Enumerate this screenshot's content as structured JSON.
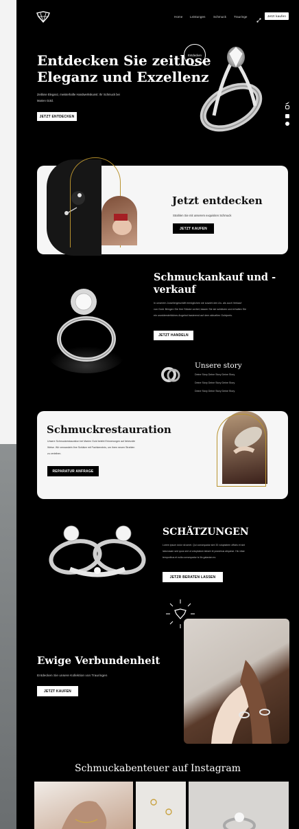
{
  "nav": {
    "items": [
      "Home",
      "Leistungen",
      "Schmuck",
      "Trauringe"
    ],
    "cta": "Jetzt kaufen"
  },
  "hero": {
    "title_line1": "Entdecken Sie zeitlose",
    "title_line2": "Eleganz und Exzellenz",
    "badge": "Entdecken",
    "subtitle_line1": "Zeitlose Eleganz, meisterhafte Handwerkskunst: Ihr Schmuck bei",
    "subtitle_line2": "Marien Gold.",
    "button": "JETZT ENTDECKEN"
  },
  "discover": {
    "title": "Jetzt entdecken",
    "text": "Strahlen Sie mit unserem exquisiten Schmuck",
    "button": "JETZT KAUFEN"
  },
  "trade": {
    "title_line1": "Schmuckankauf und -",
    "title_line2": "verkauf",
    "text_line1": "In unserem Juweliergeschäft ermöglichen wir sowohl den An- als auch Verkauf",
    "text_line2": "von Gold. Bringen Sie Ihre Stücke vorbei; lassen Sie sie schätzen und erhalten Sie",
    "text_line3": "ein unwiderstehliches Angebot basierend auf dem aktuellen Goldpreis.",
    "button": "JETZT HANDELN"
  },
  "story": {
    "title": "Unsere story",
    "lines": [
      "Deine Story Deine Story Deine Story",
      "Deine Story Deine Story Deine Story",
      "Deine Story Deine Story Deine Story"
    ]
  },
  "restoration": {
    "title": "Schmuckrestauration",
    "text_line1": "Unsere Schmuckrestauration bei Marien Gold belebt Erinnerungen auf liebevolle",
    "text_line2": "Weise. Wir verwandeln Ihre Schätze mit Fachkenntnis, um ihren neuen Strahlen",
    "text_line3": "zu verleihen.",
    "button": "REPARATUR ANFRAGE"
  },
  "appraisal": {
    "title": "SCHÄTZUNGEN",
    "text_line1": "Lorem ipsum dolor sit amet. Qui consequatur sint 33 voluptatem officiis et sint",
    "text_line2": "laborosam sed quos sint ut voluptatum labore et possimus aliquese. Hic vitae",
    "text_line3": "temporibus et nulla consequatur is illo galaxian ex.",
    "button": "JETZR BERATEN LASSEN"
  },
  "bond": {
    "title": "Ewige Verbundenheit",
    "text": "Entdecken Sie unsere Kollektion von Trauringen",
    "button": "JETZT KAUFEN"
  },
  "instagram": {
    "title": "Schmuckabenteuer auf Instagram"
  },
  "icons": [
    "logo-icon",
    "share-icon",
    "twitter-icon",
    "instagram-icon",
    "youtube-icon",
    "facebook-icon"
  ]
}
